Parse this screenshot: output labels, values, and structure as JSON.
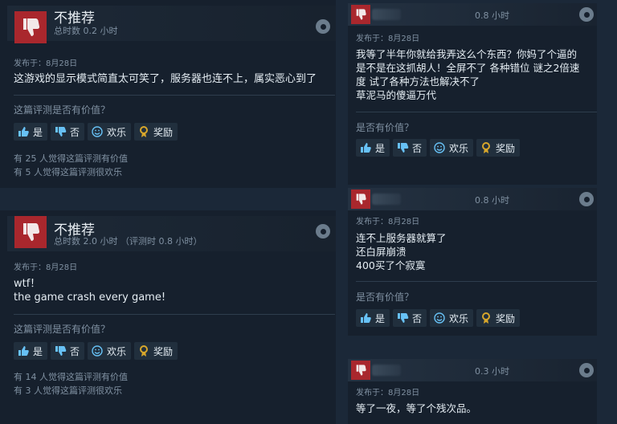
{
  "labels": {
    "not_recommended": "不推荐",
    "helpful_question_left": "这篇评测是否有价值？",
    "helpful_question_right": "是否有价值？",
    "yes": "是",
    "no": "否",
    "funny": "欢乐",
    "award": "奖励"
  },
  "colors": {
    "background": "#1b2838",
    "card": "#16202d",
    "thumb_red": "#a9272d",
    "award_gold": "#d8a72b"
  },
  "reviews_left": [
    {
      "verdict": "不推荐",
      "hours": "总时数 0.2 小时",
      "posted": "发布于：8月28日",
      "lines": [
        "这游戏的显示模式简直太可笑了，服务器也连不上，属实恶心到了"
      ],
      "helpful_count": "有 25 人觉得这篇评测有价值",
      "funny_count": "有 5 人觉得这篇评测很欢乐"
    },
    {
      "verdict": "不推荐",
      "hours": "总时数 2.0 小时 （评测时 0.8 小时）",
      "posted": "发布于：8月28日",
      "lines": [
        "wtf！",
        "the game crash every game!"
      ],
      "helpful_count": "有 14 人觉得这篇评测有价值",
      "funny_count": "有 3 人觉得这篇评测很欢乐"
    }
  ],
  "reviews_right": [
    {
      "hours": "0.8 小时",
      "posted": "发布于：8月28日",
      "lines": [
        "我等了半年你就给我弄这么个东西？你妈了个逼的",
        "是不是在这抓胡人！全屏不了 各种错位 谜之2倍速",
        "度 试了各种方法也解决不了",
        "草泥马的傻逼万代"
      ]
    },
    {
      "hours": "0.8 小时",
      "posted": "发布于：8月28日",
      "lines": [
        "连不上服务器就算了",
        "还白屏崩溃",
        "400买了个寂寞"
      ]
    },
    {
      "hours": "0.3 小时",
      "posted": "发布于：8月28日",
      "lines": [
        "等了一夜，等了个残次品。"
      ]
    }
  ]
}
